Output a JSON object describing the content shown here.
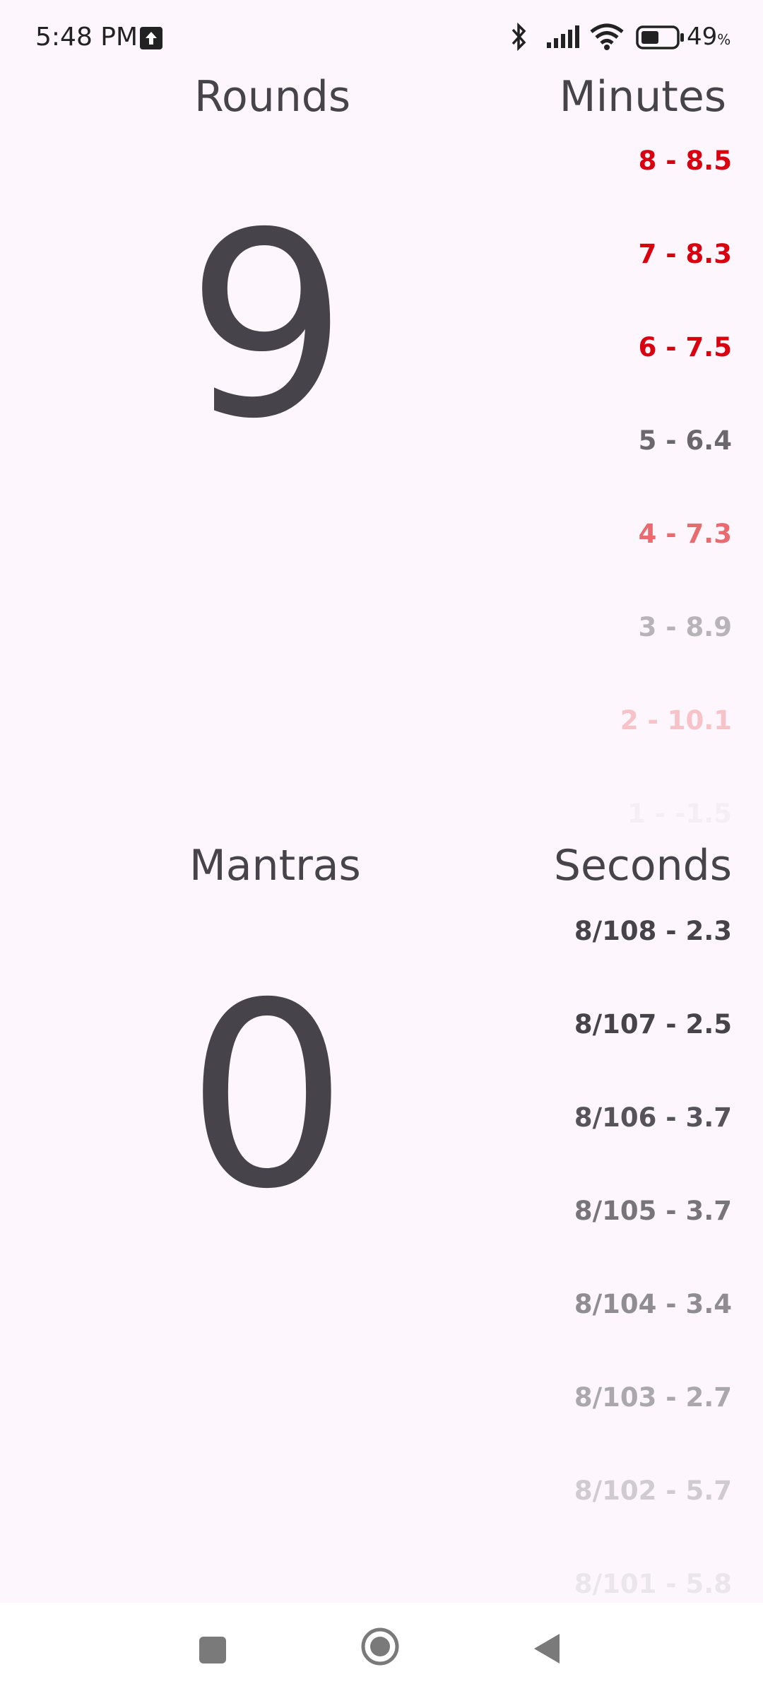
{
  "status_bar": {
    "time": "5:48 PM",
    "battery_percent": "49",
    "battery_unit": "%",
    "icons": [
      "upload-icon",
      "bluetooth-icon",
      "signal-icon",
      "wifi-icon",
      "battery-icon"
    ]
  },
  "rounds": {
    "label": "Rounds",
    "value": "9"
  },
  "minutes": {
    "label": "Minutes",
    "items": [
      "8 - 8.5",
      "7 - 8.3",
      "6 - 7.5",
      "5 - 6.4",
      "4 - 7.3",
      "3 - 8.9",
      "2 - 10.1",
      "1 - -1.5"
    ]
  },
  "mantras": {
    "label": "Mantras",
    "value": "0"
  },
  "seconds": {
    "label": "Seconds",
    "items": [
      "8/108 - 2.3",
      "8/107 - 2.5",
      "8/106 - 3.7",
      "8/105 - 3.7",
      "8/104 - 3.4",
      "8/103 - 2.7",
      "8/102 - 5.7",
      "8/101 - 5.8"
    ]
  },
  "colors": {
    "background": "#fdf6fd",
    "text": "#46434a",
    "red": "#d9000f",
    "nav_bar": "#ffffff"
  },
  "navigation": {
    "icons": [
      "recents-square-icon",
      "home-circle-icon",
      "back-triangle-icon"
    ]
  }
}
